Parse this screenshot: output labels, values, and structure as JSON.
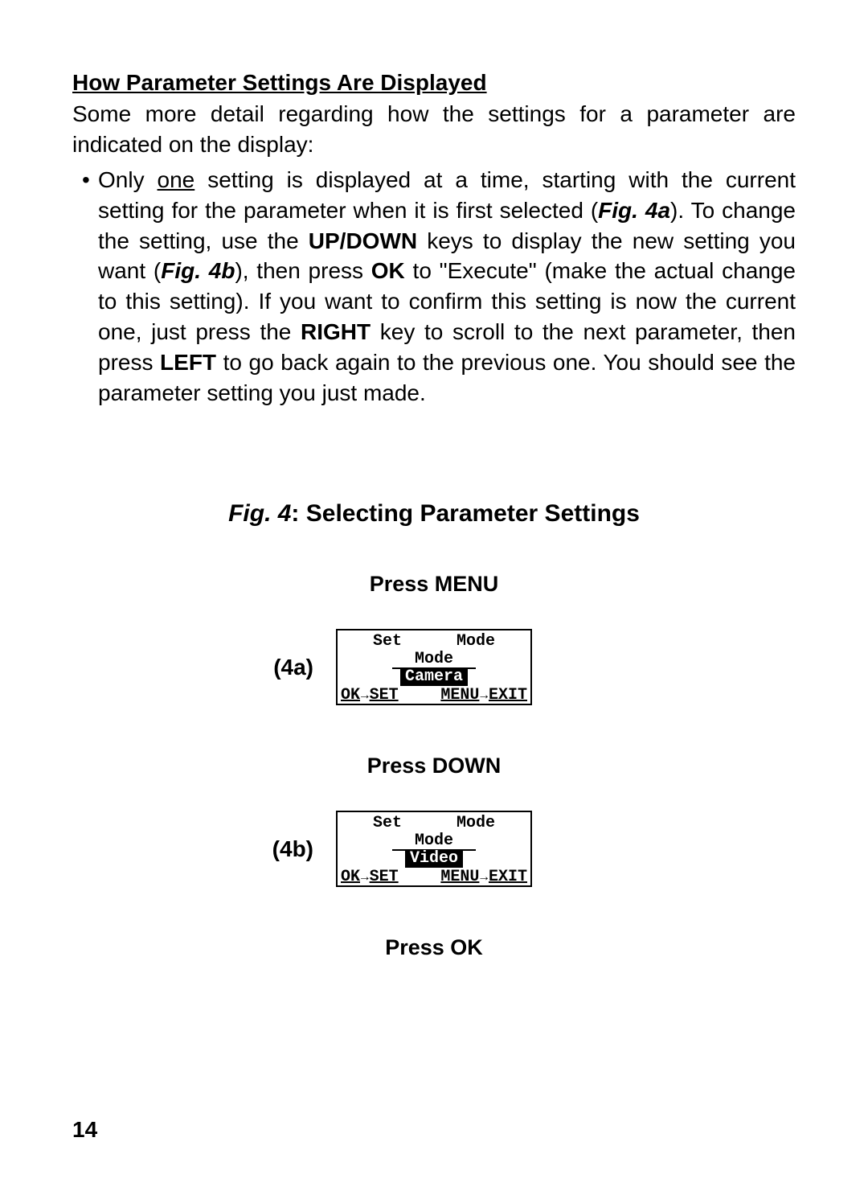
{
  "heading": "How Parameter Settings Are Displayed",
  "intro": "Some more detail regarding how the settings for a parameter are indicated on the display:",
  "bullet": {
    "t1": "Only ",
    "one": "one",
    "t2": " setting is displayed at a time, starting with the current setting for the parameter when it is first selected (",
    "fig4a": "Fig. 4a",
    "t3": "). To change the setting, use the ",
    "updown": "UP/DOWN",
    "t4": " keys to display the new setting you want (",
    "fig4b": "Fig. 4b",
    "t5": "), then press ",
    "ok": "OK",
    "t6": " to \"Execute\" (make the actual change to this setting). If you want to confirm this setting is now the current one, just press the ",
    "right": "RIGHT",
    "t7": " key to scroll to the next parameter, then press ",
    "left": "LEFT",
    "t8": " to go back again to the previous one. You should see the parameter setting you just made."
  },
  "figure": {
    "prefix": "Fig. 4",
    "rest": ": Selecting Parameter Settings"
  },
  "steps": {
    "menu": "Press MENU",
    "down": "Press DOWN",
    "ok": "Press OK"
  },
  "labels": {
    "a": "(4a)",
    "b": "(4b)"
  },
  "lcd": {
    "set": "Set",
    "mode": "Mode",
    "sub": "Mode",
    "valA": "Camera",
    "valB": "Video",
    "okset": "OK",
    "setlbl": "SET",
    "menuexit": "MENU",
    "exitlbl": "EXIT"
  },
  "pagenum": "14"
}
